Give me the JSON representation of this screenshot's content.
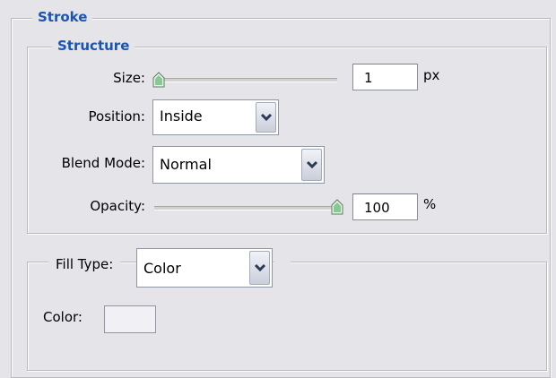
{
  "stroke": {
    "title": "Stroke",
    "structure": {
      "title": "Structure",
      "size": {
        "label": "Size:",
        "value": "1",
        "unit": "px",
        "slider_fraction": 0.0
      },
      "position": {
        "label": "Position:",
        "selected": "Inside"
      },
      "blend_mode": {
        "label": "Blend Mode:",
        "selected": "Normal"
      },
      "opacity": {
        "label": "Opacity:",
        "value": "100",
        "unit": "%",
        "slider_fraction": 1.0
      }
    },
    "fill": {
      "label": "Fill Type:",
      "selected": "Color",
      "color_label": "Color:"
    }
  },
  "colors": {
    "panel_bg": "#e5e4e9",
    "legend_text": "#1a55b3",
    "thumb_green": "#3aa44a"
  }
}
